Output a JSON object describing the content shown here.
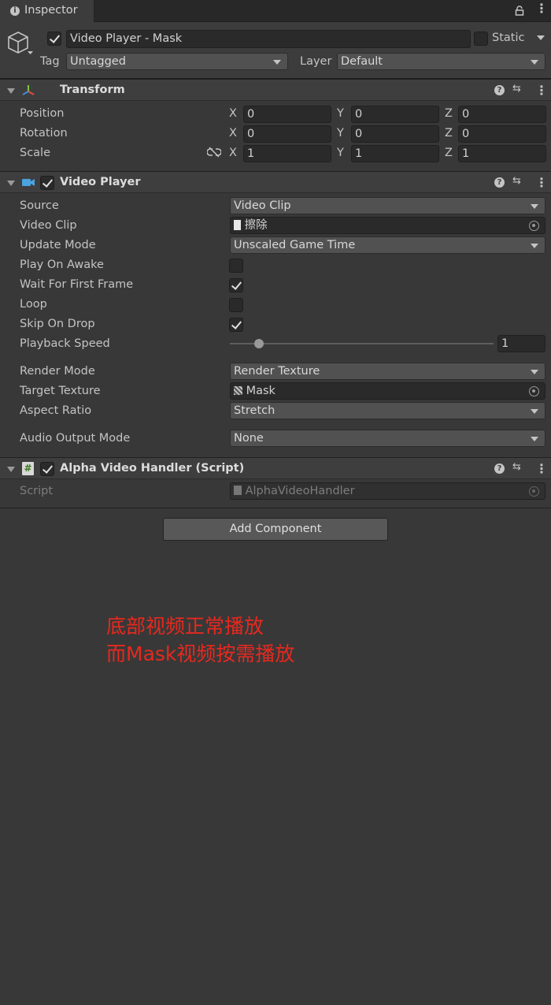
{
  "tab": {
    "title": "Inspector"
  },
  "header": {
    "object_name": "Video Player - Mask",
    "static_label": "Static",
    "tag_label": "Tag",
    "tag_value": "Untagged",
    "layer_label": "Layer",
    "layer_value": "Default"
  },
  "transform": {
    "title": "Transform",
    "position_label": "Position",
    "rotation_label": "Rotation",
    "scale_label": "Scale",
    "axis_x": "X",
    "axis_y": "Y",
    "axis_z": "Z",
    "position": {
      "x": "0",
      "y": "0",
      "z": "0"
    },
    "rotation": {
      "x": "0",
      "y": "0",
      "z": "0"
    },
    "scale": {
      "x": "1",
      "y": "1",
      "z": "1"
    }
  },
  "video_player": {
    "title": "Video Player",
    "source_label": "Source",
    "source_value": "Video Clip",
    "video_clip_label": "Video Clip",
    "video_clip_value": "擦除",
    "update_mode_label": "Update Mode",
    "update_mode_value": "Unscaled Game Time",
    "play_on_awake_label": "Play On Awake",
    "play_on_awake": false,
    "wait_first_frame_label": "Wait For First Frame",
    "wait_first_frame": true,
    "loop_label": "Loop",
    "loop": false,
    "skip_on_drop_label": "Skip On Drop",
    "skip_on_drop": true,
    "playback_speed_label": "Playback Speed",
    "playback_speed_value": "1",
    "playback_speed_fraction": 0.11,
    "render_mode_label": "Render Mode",
    "render_mode_value": "Render Texture",
    "target_texture_label": "Target Texture",
    "target_texture_value": "Mask",
    "aspect_ratio_label": "Aspect Ratio",
    "aspect_ratio_value": "Stretch",
    "audio_output_label": "Audio Output Mode",
    "audio_output_value": "None"
  },
  "alpha_handler": {
    "title": "Alpha Video Handler (Script)",
    "script_label": "Script",
    "script_value": "AlphaVideoHandler"
  },
  "add_component_label": "Add Component",
  "annotation": {
    "line1": "底部视频正常播放",
    "line2": "而Mask视频按需播放"
  },
  "colors": {
    "background": "#383838",
    "annotation_red": "#e8281e",
    "script_icon_green": "#8fd14f",
    "video_icon_blue": "#4aa3df"
  }
}
